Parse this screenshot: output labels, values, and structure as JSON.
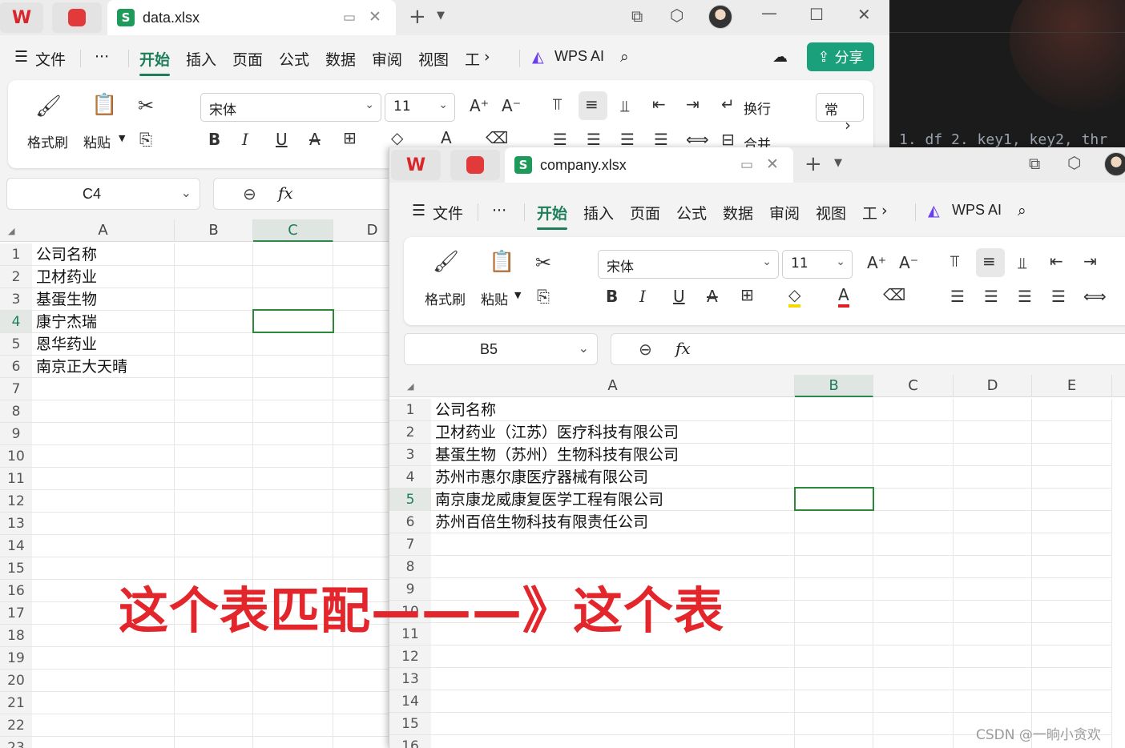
{
  "window1": {
    "tab_title": "data.xlsx",
    "menu": [
      "文件",
      "开始",
      "插入",
      "页面",
      "公式",
      "数据",
      "审阅",
      "视图",
      "工"
    ],
    "active_menu": "开始",
    "wps_ai": "WPS AI",
    "share": "分享",
    "ribbon": {
      "format_painter": "格式刷",
      "paste": "粘贴",
      "font": "宋体",
      "font_size": "11",
      "wrap": "换行",
      "merge": "合并",
      "partial": "常"
    },
    "name_box": "C4",
    "columns": [
      "A",
      "B",
      "C",
      "D"
    ],
    "selected_column": "C",
    "rows": [
      "1",
      "2",
      "3",
      "4",
      "5",
      "6",
      "7",
      "8",
      "9",
      "10",
      "11",
      "12",
      "13",
      "14",
      "15",
      "16",
      "17",
      "18",
      "19",
      "20",
      "21",
      "22",
      "23"
    ],
    "selected_row": "4",
    "cells_a": [
      "公司名称",
      "卫材药业",
      "基蛋生物",
      "康宁杰瑞",
      "恩华药业",
      "南京正大天晴"
    ]
  },
  "window2": {
    "tab_title": "company.xlsx",
    "menu": [
      "文件",
      "开始",
      "插入",
      "页面",
      "公式",
      "数据",
      "审阅",
      "视图",
      "工"
    ],
    "active_menu": "开始",
    "wps_ai": "WPS AI",
    "ribbon": {
      "format_painter": "格式刷",
      "paste": "粘贴",
      "font": "宋体",
      "font_size": "11"
    },
    "name_box": "B5",
    "columns": [
      "A",
      "B",
      "C",
      "D",
      "E"
    ],
    "selected_column": "B",
    "rows": [
      "1",
      "2",
      "3",
      "4",
      "5",
      "6",
      "7",
      "8",
      "9",
      "10",
      "11",
      "12",
      "13",
      "14",
      "15",
      "16"
    ],
    "selected_row": "5",
    "cells_a": [
      "公司名称",
      "卫材药业（江苏）医疗科技有限公司",
      "基蛋生物（苏州）生物科技有限公司",
      "苏州市惠尔康医疗器械有限公司",
      "南京康龙威康复医学工程有限公司",
      "苏州百倍生物科技有限责任公司"
    ]
  },
  "terminal": {
    "text": "1. df 2. key1, key2, thr"
  },
  "annotation": "这个表匹配———》这个表",
  "watermark": "CSDN @一晌小贪欢",
  "colors": {
    "accent": "#1e7e5a",
    "selection": "#2b8a3a",
    "annotation": "#e3262c",
    "share_bg": "#1aa07a"
  }
}
